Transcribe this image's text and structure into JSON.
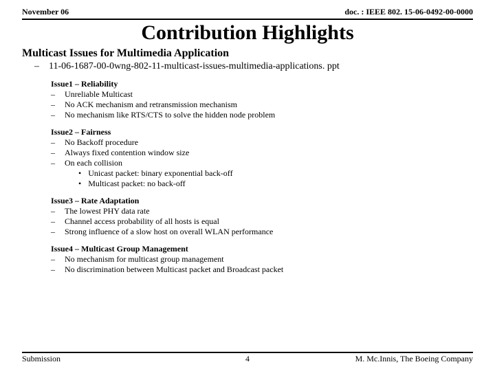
{
  "header": {
    "left": "November 06",
    "right": "doc. : IEEE 802. 15-06-0492-00-0000"
  },
  "title": "Contribution Highlights",
  "subtitle": "Multicast Issues for Multimedia Application",
  "ref": "11-06-1687-00-0wng-802-11-multicast-issues-multimedia-applications. ppt",
  "issues": [
    {
      "title": "Issue1 – Reliability",
      "subs": [
        "Unreliable Multicast",
        "No ACK mechanism and retransmission mechanism",
        "No mechanism like RTS/CTS to solve the hidden node problem"
      ]
    },
    {
      "title": "Issue2 – Fairness",
      "subs": [
        "No Backoff procedure",
        "Always fixed contention window size",
        "On each collision"
      ],
      "bullets": [
        "Unicast packet: binary exponential back-off",
        "Multicast packet: no back-off"
      ]
    },
    {
      "title": "Issue3 – Rate Adaptation",
      "subs": [
        "The lowest PHY data rate",
        "Channel access probability of all hosts is equal",
        "Strong influence of a slow host on overall WLAN performance"
      ]
    },
    {
      "title": "Issue4 – Multicast Group Management",
      "subs": [
        "No mechanism for multicast group management",
        "No discrimination between Multicast packet and Broadcast packet"
      ]
    }
  ],
  "footer": {
    "left": "Submission",
    "center": "4",
    "right": "M. Mc.Innis, The Boeing Company"
  }
}
